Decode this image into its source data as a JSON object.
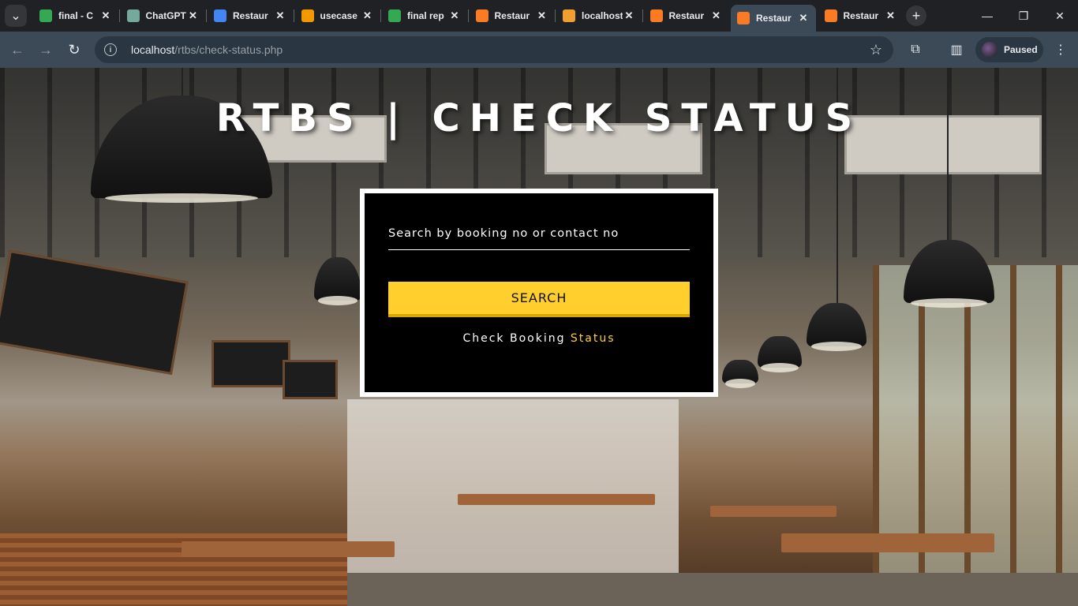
{
  "browser": {
    "tabs": [
      {
        "title": "final - C",
        "icon": "refresh-green-icon",
        "color": "#34a853",
        "active": false
      },
      {
        "title": "ChatGPT",
        "icon": "openai-icon",
        "color": "#74aa9c",
        "active": false
      },
      {
        "title": "Restaur",
        "icon": "gear-blue-icon",
        "color": "#4285f4",
        "active": false
      },
      {
        "title": "usecase",
        "icon": "diagram-orange-icon",
        "color": "#f29900",
        "active": false
      },
      {
        "title": "final rep",
        "icon": "refresh-green-icon",
        "color": "#34a853",
        "active": false
      },
      {
        "title": "Restaur",
        "icon": "xampp-icon",
        "color": "#fb7a24",
        "active": false
      },
      {
        "title": "localhost",
        "icon": "phpmyadmin-icon",
        "color": "#f0a030",
        "active": false
      },
      {
        "title": "Restaur",
        "icon": "xampp-icon",
        "color": "#fb7a24",
        "active": false
      },
      {
        "title": "Restaur",
        "icon": "xampp-icon",
        "color": "#fb7a24",
        "active": true
      },
      {
        "title": "Restaur",
        "icon": "xampp-icon",
        "color": "#fb7a24",
        "active": false
      }
    ],
    "url_host": "localhost",
    "url_path": "/rtbs/check-status.php",
    "profile_label": "Paused"
  },
  "page": {
    "title": "RTBS | CHECK STATUS",
    "search_label": "Search by booking no or contact no",
    "search_button": "SEARCH",
    "check_text_plain": "Check Booking ",
    "check_text_highlight": "Status",
    "accent_color": "#ffd02d"
  }
}
